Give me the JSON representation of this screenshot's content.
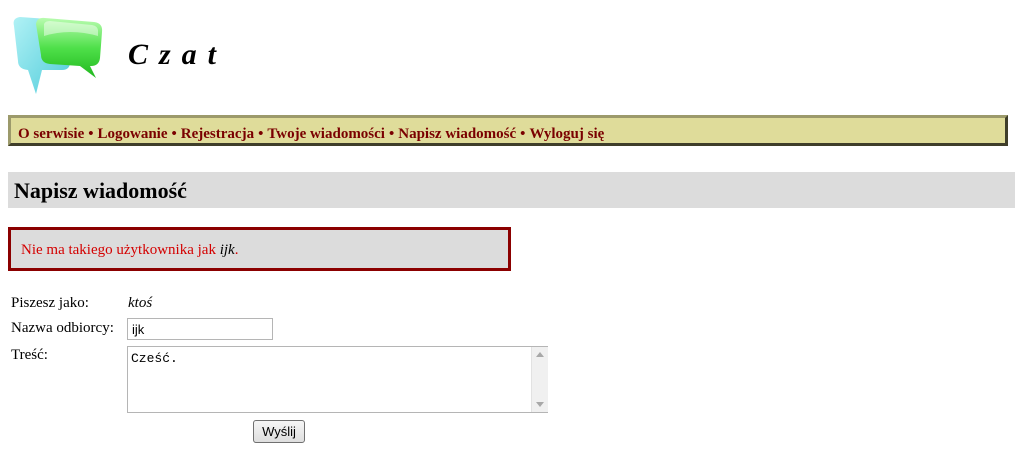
{
  "site": {
    "title": "Czat"
  },
  "nav": {
    "items": [
      {
        "label": "O serwisie"
      },
      {
        "label": "Logowanie"
      },
      {
        "label": "Rejestracja"
      },
      {
        "label": "Twoje wiadomości"
      },
      {
        "label": "Napisz wiadomość"
      },
      {
        "label": "Wyloguj się"
      }
    ],
    "separator": "•"
  },
  "page": {
    "heading": "Napisz wiadomość"
  },
  "error": {
    "text": "Nie ma takiego użytkownika jak ",
    "username": "ijk",
    "suffix": "."
  },
  "form": {
    "author_label": "Piszesz jako:",
    "author_value": "ktoś",
    "recipient_label": "Nazwa odbiorcy:",
    "recipient_value": "ijk",
    "content_label": "Treść:",
    "content_value": "Cześć.",
    "submit_label": "Wyślij"
  },
  "colors": {
    "nav_background": "#dfdc9a",
    "nav_link": "#7a0000",
    "error_border": "#8b0000",
    "error_text": "#d40000",
    "section_background": "#dcdcdc"
  }
}
